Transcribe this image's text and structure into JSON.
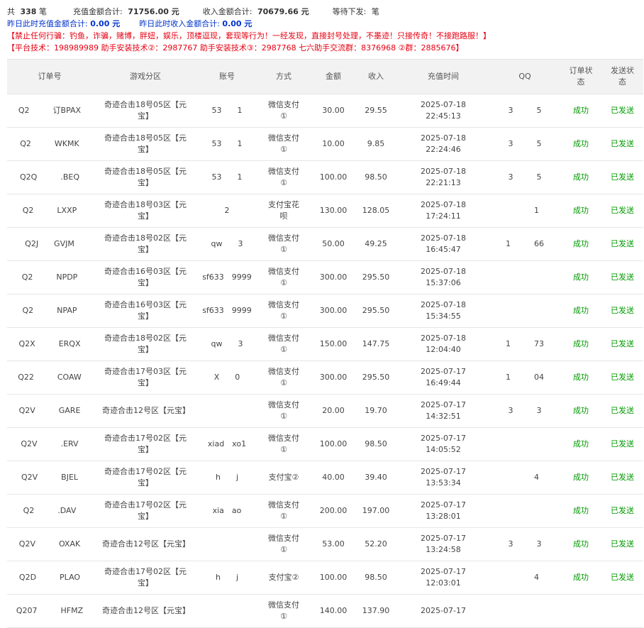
{
  "summary": {
    "total_prefix": "共",
    "total_count": "338",
    "total_unit": "笔",
    "recharge_total_label": "充值金额合计:",
    "recharge_total_value": "71756.00 元",
    "income_total_label": "收入金额合计:",
    "income_total_value": "70679.66 元",
    "pending_label": "等待下发:",
    "pending_unit": "笔",
    "yesterday_recharge_label": "昨日此时充值金额合计:",
    "yesterday_recharge_value": "0.00 元",
    "yesterday_income_label": "昨日此时收入金额合计:",
    "yesterday_income_value": "0.00 元",
    "notice_1": "【禁止任何行骗：钓鱼，诈骗，赌博，胖妞，娱乐，顶楼逗现，套现等行为！一经发现，直接封号处理，不墨迹！只接传奇！不接跑路服！】",
    "notice_2": "【平台技术：198989989 助手安装技术②：2987767 助手安装技术③：2987768 七六助手交流群：8376968 ②群：2885676】"
  },
  "table": {
    "headers": [
      "订单号",
      "游戏分区",
      "账号",
      "方式",
      "金额",
      "收入",
      "充值时间",
      "QQ",
      "订单状态",
      "发送状态"
    ],
    "rows": [
      {
        "order": "Q2　　　订BPAX",
        "zone": "奇迹合击18号05区【元宝】",
        "account": "53　　1",
        "method": "微信支付①",
        "amount": "30.00",
        "income": "29.55",
        "date": "2025-07-18",
        "time": "22:45:13",
        "qq": "3　　　5",
        "status": "成功",
        "send": "已发送"
      },
      {
        "order": "Q2　　　WKMK",
        "zone": "奇迹合击18号05区【元宝】",
        "account": "53　　1",
        "method": "微信支付①",
        "amount": "10.00",
        "income": "9.85",
        "date": "2025-07-18",
        "time": "22:24:46",
        "qq": "3　　　5",
        "status": "成功",
        "send": "已发送"
      },
      {
        "order": "Q2Q　　　.BEQ",
        "zone": "奇迹合击18号05区【元宝】",
        "account": "53　　1",
        "method": "微信支付①",
        "amount": "100.00",
        "income": "98.50",
        "date": "2025-07-18",
        "time": "22:21:13",
        "qq": "3　　　5",
        "status": "成功",
        "send": "已发送"
      },
      {
        "order": "Q2　　　LXXP",
        "zone": "奇迹合击18号03区【元宝】",
        "account": "2　　",
        "method": "支付宝花呗",
        "amount": "130.00",
        "income": "128.05",
        "date": "2025-07-18",
        "time": "17:24:11",
        "qq": "　　　1",
        "status": "成功",
        "send": "已发送"
      },
      {
        "order": "Q2J　　GVJM",
        "zone": "奇迹合击18号02区【元宝】",
        "account": "qw　　3",
        "method": "微信支付①",
        "amount": "50.00",
        "income": "49.25",
        "date": "2025-07-18",
        "time": "16:45:47",
        "qq": "1　　　66",
        "status": "成功",
        "send": "已发送"
      },
      {
        "order": "Q2　　　NPDP",
        "zone": "奇迹合击16号03区【元宝】",
        "account": "sf633　9999",
        "method": "微信支付①",
        "amount": "300.00",
        "income": "295.50",
        "date": "2025-07-18",
        "time": "15:37:06",
        "qq": "",
        "status": "成功",
        "send": "已发送"
      },
      {
        "order": "Q2　　　NPAP",
        "zone": "奇迹合击16号03区【元宝】",
        "account": "sf633　9999",
        "method": "微信支付①",
        "amount": "300.00",
        "income": "295.50",
        "date": "2025-07-18",
        "time": "15:34:55",
        "qq": "",
        "status": "成功",
        "send": "已发送"
      },
      {
        "order": "Q2X　　　ERQX",
        "zone": "奇迹合击18号02区【元宝】",
        "account": "qw　　3",
        "method": "微信支付①",
        "amount": "150.00",
        "income": "147.75",
        "date": "2025-07-18",
        "time": "12:04:40",
        "qq": "1　　　73",
        "status": "成功",
        "send": "已发送"
      },
      {
        "order": "Q22　　　COAW",
        "zone": "奇迹合击17号03区【元宝】",
        "account": "X　　0",
        "method": "微信支付①",
        "amount": "300.00",
        "income": "295.50",
        "date": "2025-07-17",
        "time": "16:49:44",
        "qq": "1　　　04",
        "status": "成功",
        "send": "已发送"
      },
      {
        "order": "Q2V　　　GARE",
        "zone": "奇迹合击12号区【元宝】",
        "account": "",
        "method": "微信支付①",
        "amount": "20.00",
        "income": "19.70",
        "date": "2025-07-17",
        "time": "14:32:51",
        "qq": "3　　　3",
        "status": "成功",
        "send": "已发送"
      },
      {
        "order": "Q2V　　　.ERV",
        "zone": "奇迹合击17号02区【元宝】",
        "account": "xiad　xo1",
        "method": "微信支付①",
        "amount": "100.00",
        "income": "98.50",
        "date": "2025-07-17",
        "time": "14:05:52",
        "qq": "",
        "status": "成功",
        "send": "已发送"
      },
      {
        "order": "Q2V　　　BJEL",
        "zone": "奇迹合击17号02区【元宝】",
        "account": "h　　j",
        "method": "支付宝②",
        "amount": "40.00",
        "income": "39.40",
        "date": "2025-07-17",
        "time": "13:53:34",
        "qq": "　　　4",
        "status": "成功",
        "send": "已发送"
      },
      {
        "order": "Q2　　　.DAV",
        "zone": "奇迹合击17号02区【元宝】",
        "account": "xia　ao",
        "method": "微信支付①",
        "amount": "200.00",
        "income": "197.00",
        "date": "2025-07-17",
        "time": "13:28:01",
        "qq": "",
        "status": "成功",
        "send": "已发送"
      },
      {
        "order": "Q2V　　　OXAK",
        "zone": "奇迹合击12号区【元宝】",
        "account": "",
        "method": "微信支付①",
        "amount": "53.00",
        "income": "52.20",
        "date": "2025-07-17",
        "time": "13:24:58",
        "qq": "3　　　3",
        "status": "成功",
        "send": "已发送"
      },
      {
        "order": "Q2D　　　PLAO",
        "zone": "奇迹合击17号02区【元宝】",
        "account": "h　　j",
        "method": "支付宝②",
        "amount": "100.00",
        "income": "98.50",
        "date": "2025-07-17",
        "time": "12:03:01",
        "qq": "　　　4",
        "status": "成功",
        "send": "已发送"
      },
      {
        "order": "Q207　　　HFMZ",
        "zone": "奇迹合击12号区【元宝】",
        "account": "",
        "method": "微信支付①",
        "amount": "140.00",
        "income": "137.90",
        "date": "2025-07-17",
        "time": "",
        "qq": "",
        "status": "",
        "send": ""
      }
    ]
  }
}
